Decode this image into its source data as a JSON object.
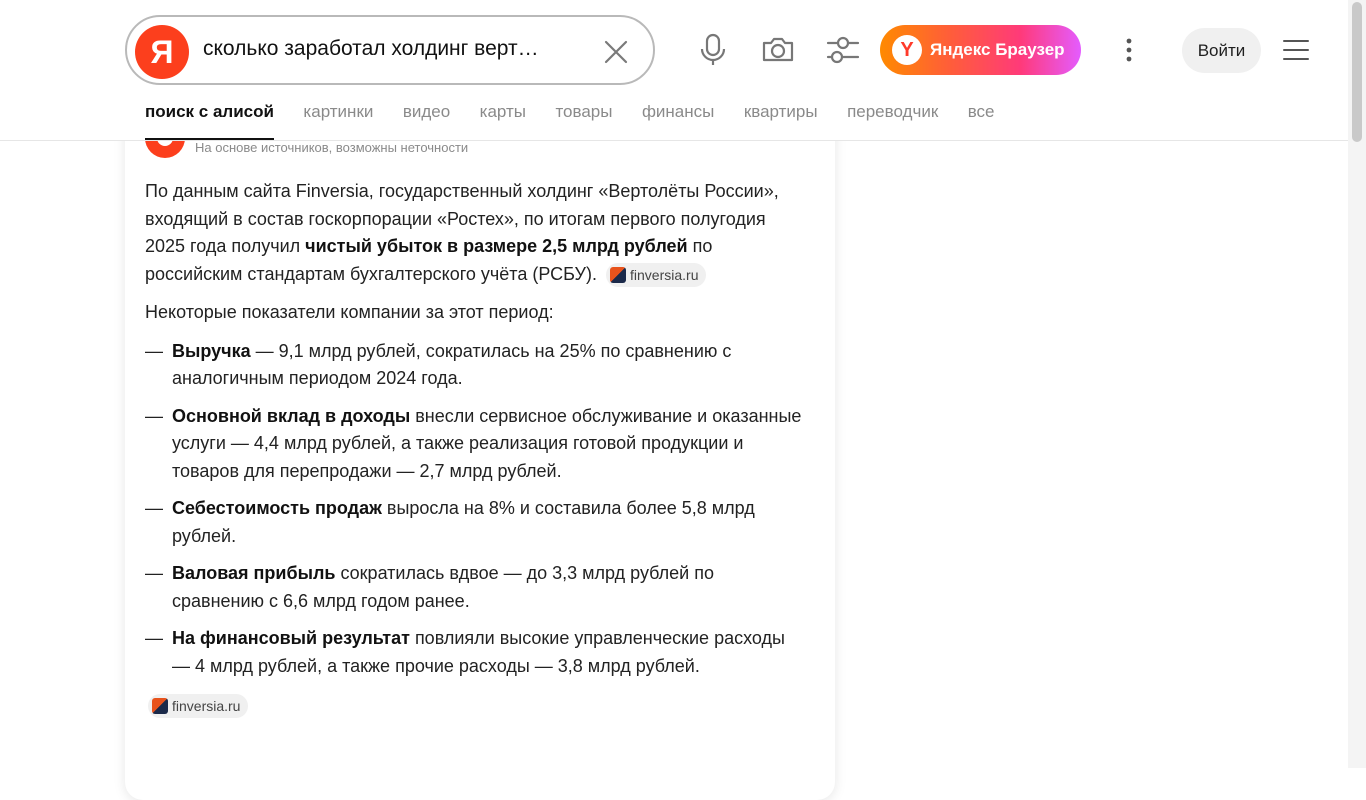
{
  "search": {
    "logo_letter": "Я",
    "query": "сколько заработал холдинг верт…"
  },
  "header": {
    "browser_button_label": "Яндекс Браузер",
    "browser_logo_letter": "Y",
    "login_label": "Войти"
  },
  "tabs": [
    {
      "label": "поиск с алисой",
      "active": true
    },
    {
      "label": "картинки"
    },
    {
      "label": "видео"
    },
    {
      "label": "карты"
    },
    {
      "label": "товары"
    },
    {
      "label": "финансы"
    },
    {
      "label": "квартиры"
    },
    {
      "label": "переводчик"
    },
    {
      "label": "все"
    }
  ],
  "answer": {
    "disclaimer": "На основе источников, возможны неточности",
    "intro": {
      "part1": "По данным сайта Finversia, государственный холдинг «Вертолёты России», входящий в состав госкорпорации «Ростех», по итогам первого полугодия 2025 года получил ",
      "bold": "чистый убыток в размере 2,5 млрд рублей",
      "part2": " по российским стандартам бухгалтерского учёта (РСБУ).",
      "source": "finversia.ru"
    },
    "lead": "Некоторые показатели компании за этот период:",
    "dash": "—",
    "items": [
      {
        "bold": "Выручка",
        "text": " — 9,1 млрд рублей, сократилась на 25% по сравнению с аналогичным периодом 2024 года."
      },
      {
        "bold": "Основной вклад в доходы",
        "text": " внесли сервисное обслуживание и оказанные услуги — 4,4 млрд рублей, а также реализация готовой продукции и товаров для перепродажи — 2,7 млрд рублей."
      },
      {
        "bold": "Себестоимость продаж",
        "text": " выросла на 8% и составила более 5,8 млрд рублей."
      },
      {
        "bold": "Валовая прибыль",
        "text": " сократилась вдвое — до 3,3 млрд рублей по сравнению с 6,6 млрд годом ранее."
      },
      {
        "bold": "На финансовый результат",
        "text": " повлияли высокие управленческие расходы — 4 млрд рублей, а также прочие расходы — 3,8 млрд рублей."
      }
    ],
    "bottom_source": "finversia.ru"
  },
  "icons": {
    "clear": "close-icon",
    "voice": "microphone-icon",
    "camera": "camera-icon",
    "filters": "filters-icon",
    "more": "kebab-icon",
    "menu": "hamburger-icon"
  },
  "colors": {
    "brand_red": "#fc3f1d",
    "tab_inactive": "#8a8a8a",
    "login_bg": "#f0f0f0"
  }
}
